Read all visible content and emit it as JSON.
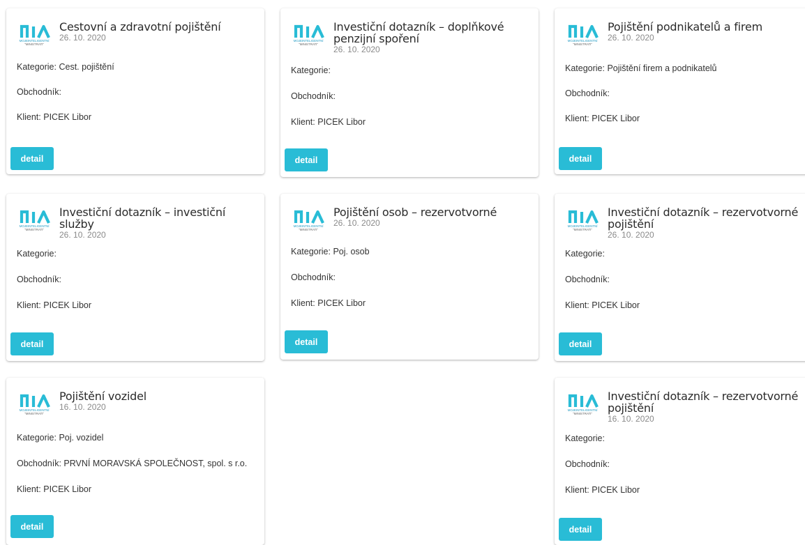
{
  "logo": {
    "line1": "MOJEINTELIGENTNÍ",
    "line2": "\"MINISTRATI\"",
    "color": "#2a9fc6"
  },
  "labels": {
    "category": "Kategorie:",
    "dealer": "Obchodník:",
    "client": "Klient:"
  },
  "accent": "#29bcd6",
  "cards": [
    {
      "title": "Cestovní a zdravotní pojištění",
      "date": "26. 10. 2020",
      "category": "Cest. pojištění",
      "dealer": "",
      "client": "PICEK Libor",
      "button": "detail"
    },
    {
      "title": "Investiční dotazník – doplňkové penzijní spoření",
      "date": "26. 10. 2020",
      "category": "",
      "dealer": "",
      "client": "PICEK Libor",
      "button": "detail"
    },
    {
      "title": "Pojištění podnikatelů a firem",
      "date": "26. 10. 2020",
      "category": "Pojištění firem a podnikatelů",
      "dealer": "",
      "client": "PICEK Libor",
      "button": "detail"
    },
    {
      "title": "Investiční dotazník – investiční služby",
      "date": "26. 10. 2020",
      "category": "",
      "dealer": "",
      "client": "PICEK Libor",
      "button": "detail"
    },
    {
      "title": "Pojištění osob – rezervotvorné",
      "date": "26. 10. 2020",
      "category": "Poj. osob",
      "dealer": "",
      "client": "PICEK Libor",
      "button": "detail"
    },
    {
      "title": "Investiční dotazník – rezervotvorné pojištění",
      "date": "26. 10. 2020",
      "category": "",
      "dealer": "",
      "client": "PICEK Libor",
      "button": "detail"
    },
    {
      "title": "Pojištění vozidel",
      "date": "16. 10. 2020",
      "category": "Poj. vozidel",
      "dealer": "PRVNÍ MORAVSKÁ SPOLEČNOST, spol. s r.o.",
      "client": "PICEK Libor",
      "button": "detail"
    },
    {
      "title": "Investiční dotazník – rezervotvorné pojištění",
      "date": "16. 10. 2020",
      "category": "",
      "dealer": "",
      "client": "PICEK Libor",
      "button": "detail"
    }
  ]
}
